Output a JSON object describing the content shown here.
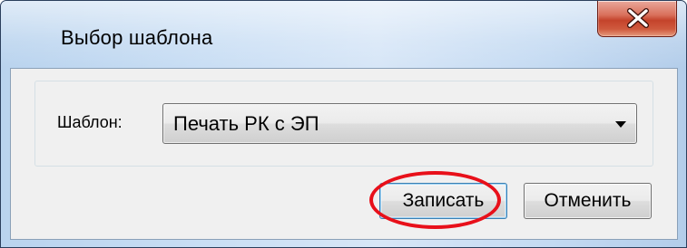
{
  "window": {
    "title": "Выбор шаблона",
    "close_icon": "close-x-icon"
  },
  "form": {
    "template_label": "Шаблон:",
    "template_selected": "Печать РК с ЭП",
    "dropdown_icon": "chevron-down-icon"
  },
  "buttons": {
    "save_label": "Записать",
    "cancel_label": "Отменить"
  },
  "annotation": {
    "highlight_color": "#e8101a",
    "highlighted_element": "save-button"
  },
  "colors": {
    "close_button": "#c4432b",
    "dialog_background": "#f0f0f0",
    "title_glass": "#c9def4"
  }
}
